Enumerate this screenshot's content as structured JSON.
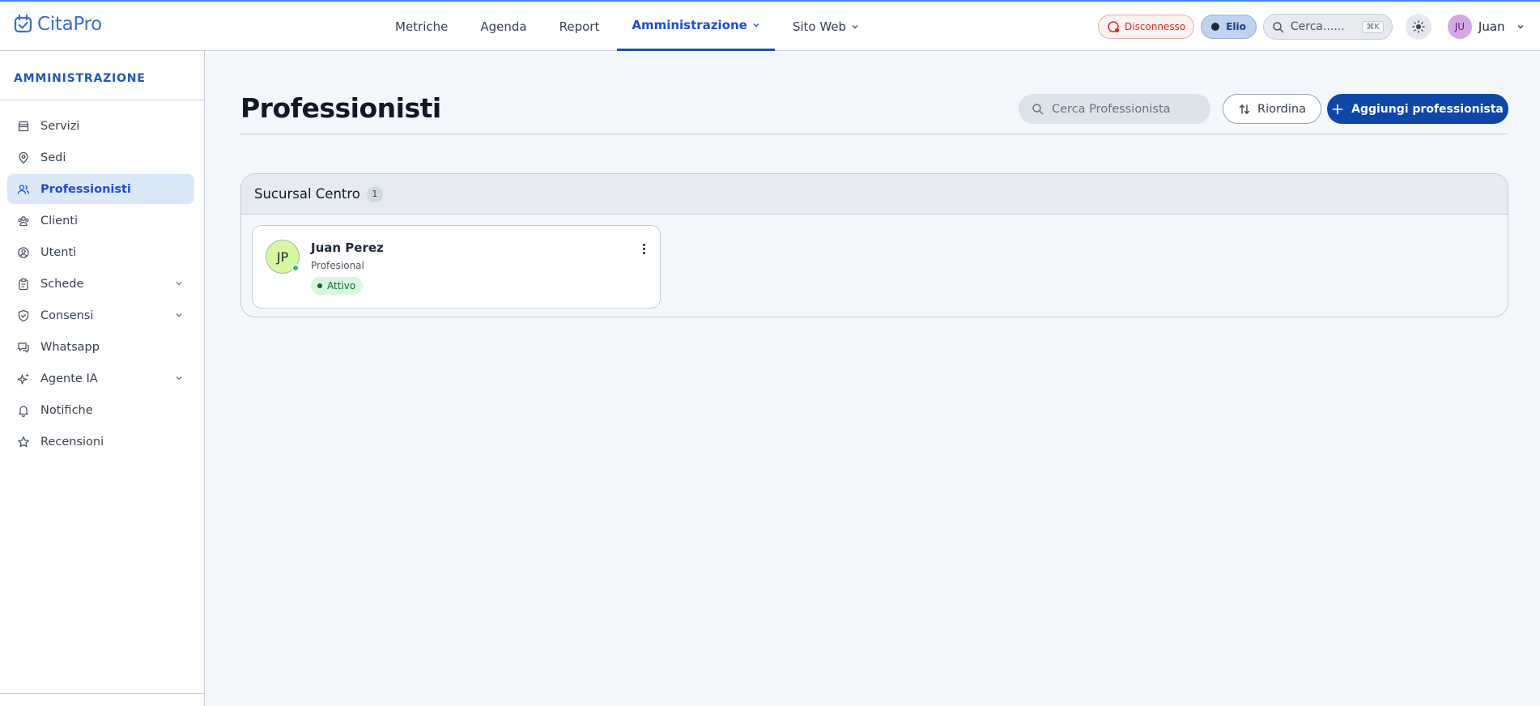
{
  "app": {
    "name": "CitaPro"
  },
  "colors": {
    "accent": "#1d4ed8",
    "primary_button": "#0f47a8",
    "active_bg": "#dbe8f7",
    "status_active": "#22c55e",
    "disconnected": "#dc2626"
  },
  "nav": {
    "items": [
      {
        "label": "Metriche",
        "active": false
      },
      {
        "label": "Agenda",
        "active": false
      },
      {
        "label": "Report",
        "active": false
      },
      {
        "label": "Amministrazione",
        "active": true,
        "dropdown": true
      },
      {
        "label": "Sito Web",
        "active": false,
        "dropdown": true
      }
    ]
  },
  "topbar": {
    "whatsapp_status": "Disconnesso",
    "assistant": "Elio",
    "search_placeholder": "Cerca......",
    "shortcut": "⌘K",
    "user_initials": "JU",
    "user_name": "Juan"
  },
  "sidebar": {
    "title": "AMMINISTRAZIONE",
    "items": [
      {
        "label": "Servizi",
        "icon": "store-icon",
        "active": false
      },
      {
        "label": "Sedi",
        "icon": "map-pin-icon",
        "active": false
      },
      {
        "label": "Professionisti",
        "icon": "users-icon",
        "active": true
      },
      {
        "label": "Clienti",
        "icon": "group-icon",
        "active": false
      },
      {
        "label": "Utenti",
        "icon": "user-circle-icon",
        "active": false
      },
      {
        "label": "Schede",
        "icon": "clipboard-icon",
        "active": false,
        "expandable": true
      },
      {
        "label": "Consensi",
        "icon": "shield-check-icon",
        "active": false,
        "expandable": true
      },
      {
        "label": "Whatsapp",
        "icon": "chat-icon",
        "active": false
      },
      {
        "label": "Agente IA",
        "icon": "sparkles-icon",
        "active": false,
        "expandable": true
      },
      {
        "label": "Notifiche",
        "icon": "bell-icon",
        "active": false
      },
      {
        "label": "Recensioni",
        "icon": "star-icon",
        "active": false
      }
    ]
  },
  "main": {
    "title": "Professionisti",
    "search_placeholder": "Cerca Professionista",
    "reorder_label": "Riordina",
    "add_label": "Aggiungi professionista",
    "groups": [
      {
        "name": "Sucursal Centro",
        "count": "1",
        "professionals": [
          {
            "initials": "JP",
            "name": "Juan Perez",
            "role": "Profesional",
            "status": "Attivo",
            "online": true
          }
        ]
      }
    ]
  }
}
